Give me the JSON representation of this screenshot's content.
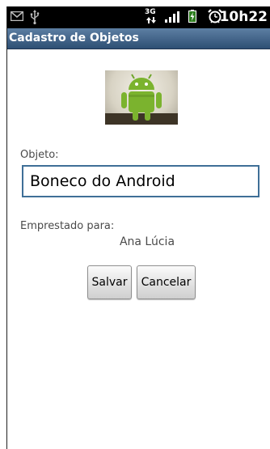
{
  "status_bar": {
    "network_label": "3G",
    "time": "10h22",
    "icons": [
      "mail-icon",
      "usb-icon",
      "network-3g-icon",
      "signal-icon",
      "battery-icon",
      "alarm-icon"
    ]
  },
  "title_bar": {
    "title": "Cadastro de Objetos"
  },
  "form": {
    "object_label": "Objeto:",
    "object_value": "Boneco do Android",
    "lent_to_label": "Emprestado para:",
    "lent_to_value": "Ana Lúcia"
  },
  "buttons": {
    "save_label": "Salvar",
    "cancel_label": "Cancelar"
  },
  "colors": {
    "title_bar": "#3f6187",
    "input_border": "#3f6f97",
    "android_green": "#7bb32e"
  }
}
